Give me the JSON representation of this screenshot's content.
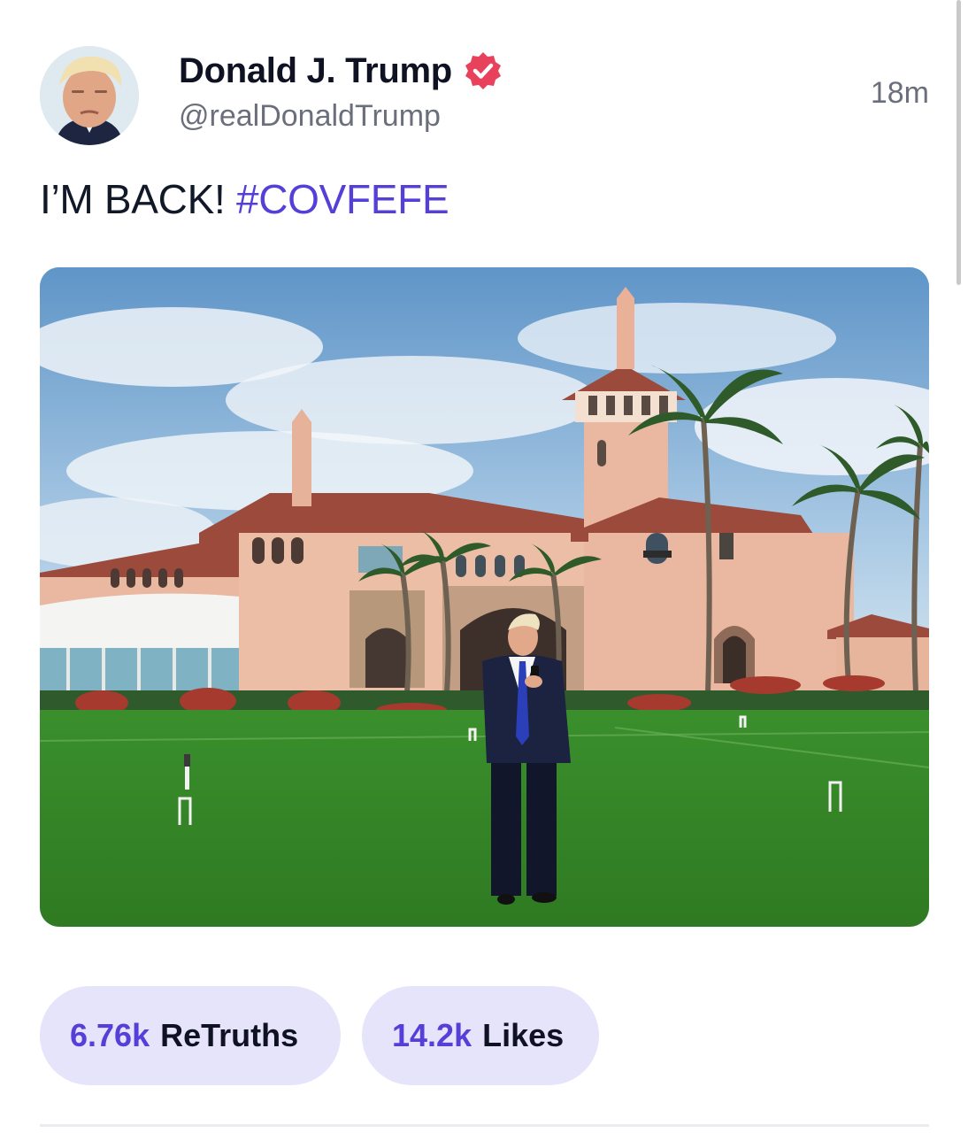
{
  "post": {
    "author": {
      "display_name": "Donald J. Trump",
      "handle": "@realDonaldTrump",
      "verified_icon": "verified-badge-icon",
      "avatar_icon": "profile-avatar"
    },
    "timestamp": "18m",
    "text": {
      "body": "I’M BACK! ",
      "hashtag": "#COVFEFE"
    },
    "media": {
      "type": "photo"
    },
    "stats": {
      "retruths_count": "6.76k",
      "retruths_label": "ReTruths",
      "likes_count": "14.2k",
      "likes_label": "Likes"
    }
  },
  "colors": {
    "accent": "#5440d8",
    "pill_background": "#e6e4fb",
    "verified": "#e8415c",
    "muted_text": "#6b6f7b"
  }
}
